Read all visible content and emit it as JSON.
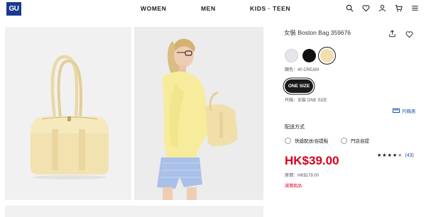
{
  "header": {
    "logo": "GU",
    "nav": [
      "WOMEN",
      "MEN",
      "KIDS · TEEN"
    ],
    "icons": [
      "search-icon",
      "heart-icon",
      "user-icon",
      "cart-icon",
      "menu-icon"
    ]
  },
  "product": {
    "title": "女裝 Boston Bag 359676",
    "colors": [
      {
        "name": "light-gray",
        "hex": "#e6e6ea"
      },
      {
        "name": "black",
        "hex": "#111111"
      },
      {
        "name": "cream",
        "hex": "#f2dfae"
      }
    ],
    "selected_color_index": 2,
    "color_label": "顏色：40 CREAM",
    "size_button": "ONE SIZE",
    "size_label": "尺碼：女裝 ONE SIZE",
    "size_chart": "尺碼表",
    "delivery_title": "配送方式",
    "delivery_options": [
      "快遞配送/自提點",
      "門店自提"
    ],
    "price": "HK$39.00",
    "rating": 4.5,
    "review_count": "(43)",
    "original_price": "原價：HK$179.00",
    "discount_label": "減價商品"
  },
  "colors": {
    "accent_red": "#d9001b",
    "link_blue": "#1a4fa8",
    "logo_blue": "#1a3a8f"
  }
}
